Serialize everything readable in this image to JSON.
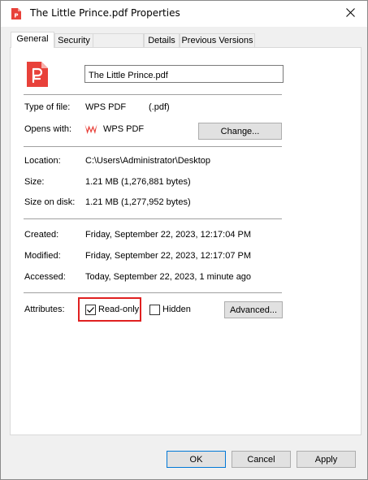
{
  "window": {
    "title": "The Little Prince.pdf Properties",
    "icons": {
      "app": "pdf-file-icon",
      "close": "close-icon"
    }
  },
  "tabs": [
    {
      "label": "General",
      "active": true
    },
    {
      "label": "Security",
      "active": false
    },
    {
      "label": "Details",
      "active": false
    },
    {
      "label": "Previous Versions",
      "active": false
    }
  ],
  "file": {
    "name": "The Little Prince.pdf",
    "icon": "pdf-file-icon",
    "type_label": "Type of file:",
    "type_value": "WPS PDF",
    "type_ext": "(.pdf)",
    "opens_label": "Opens with:",
    "opens_app": "WPS PDF",
    "opens_app_icon": "wps-logo-icon",
    "change_button": "Change..."
  },
  "location": {
    "location_label": "Location:",
    "location_value": "C:\\Users\\Administrator\\Desktop",
    "size_label": "Size:",
    "size_value": "1.21 MB (1,276,881 bytes)",
    "size_on_disk_label": "Size on disk:",
    "size_on_disk_value": "1.21 MB (1,277,952 bytes)"
  },
  "dates": {
    "created_label": "Created:",
    "created_value": "Friday, September 22, 2023, 12:17:04 PM",
    "modified_label": "Modified:",
    "modified_value": "Friday, September 22, 2023, 12:17:07 PM",
    "accessed_label": "Accessed:",
    "accessed_value": "Today, September 22, 2023, 1 minute ago"
  },
  "attributes": {
    "label": "Attributes:",
    "readonly_label": "Read-only",
    "readonly_checked": true,
    "hidden_label": "Hidden",
    "hidden_checked": false,
    "advanced_button": "Advanced..."
  },
  "footer": {
    "ok": "OK",
    "cancel": "Cancel",
    "apply": "Apply"
  },
  "colors": {
    "pdf_red": "#e8413a",
    "highlight": "#e02020",
    "accent": "#0078d7"
  }
}
